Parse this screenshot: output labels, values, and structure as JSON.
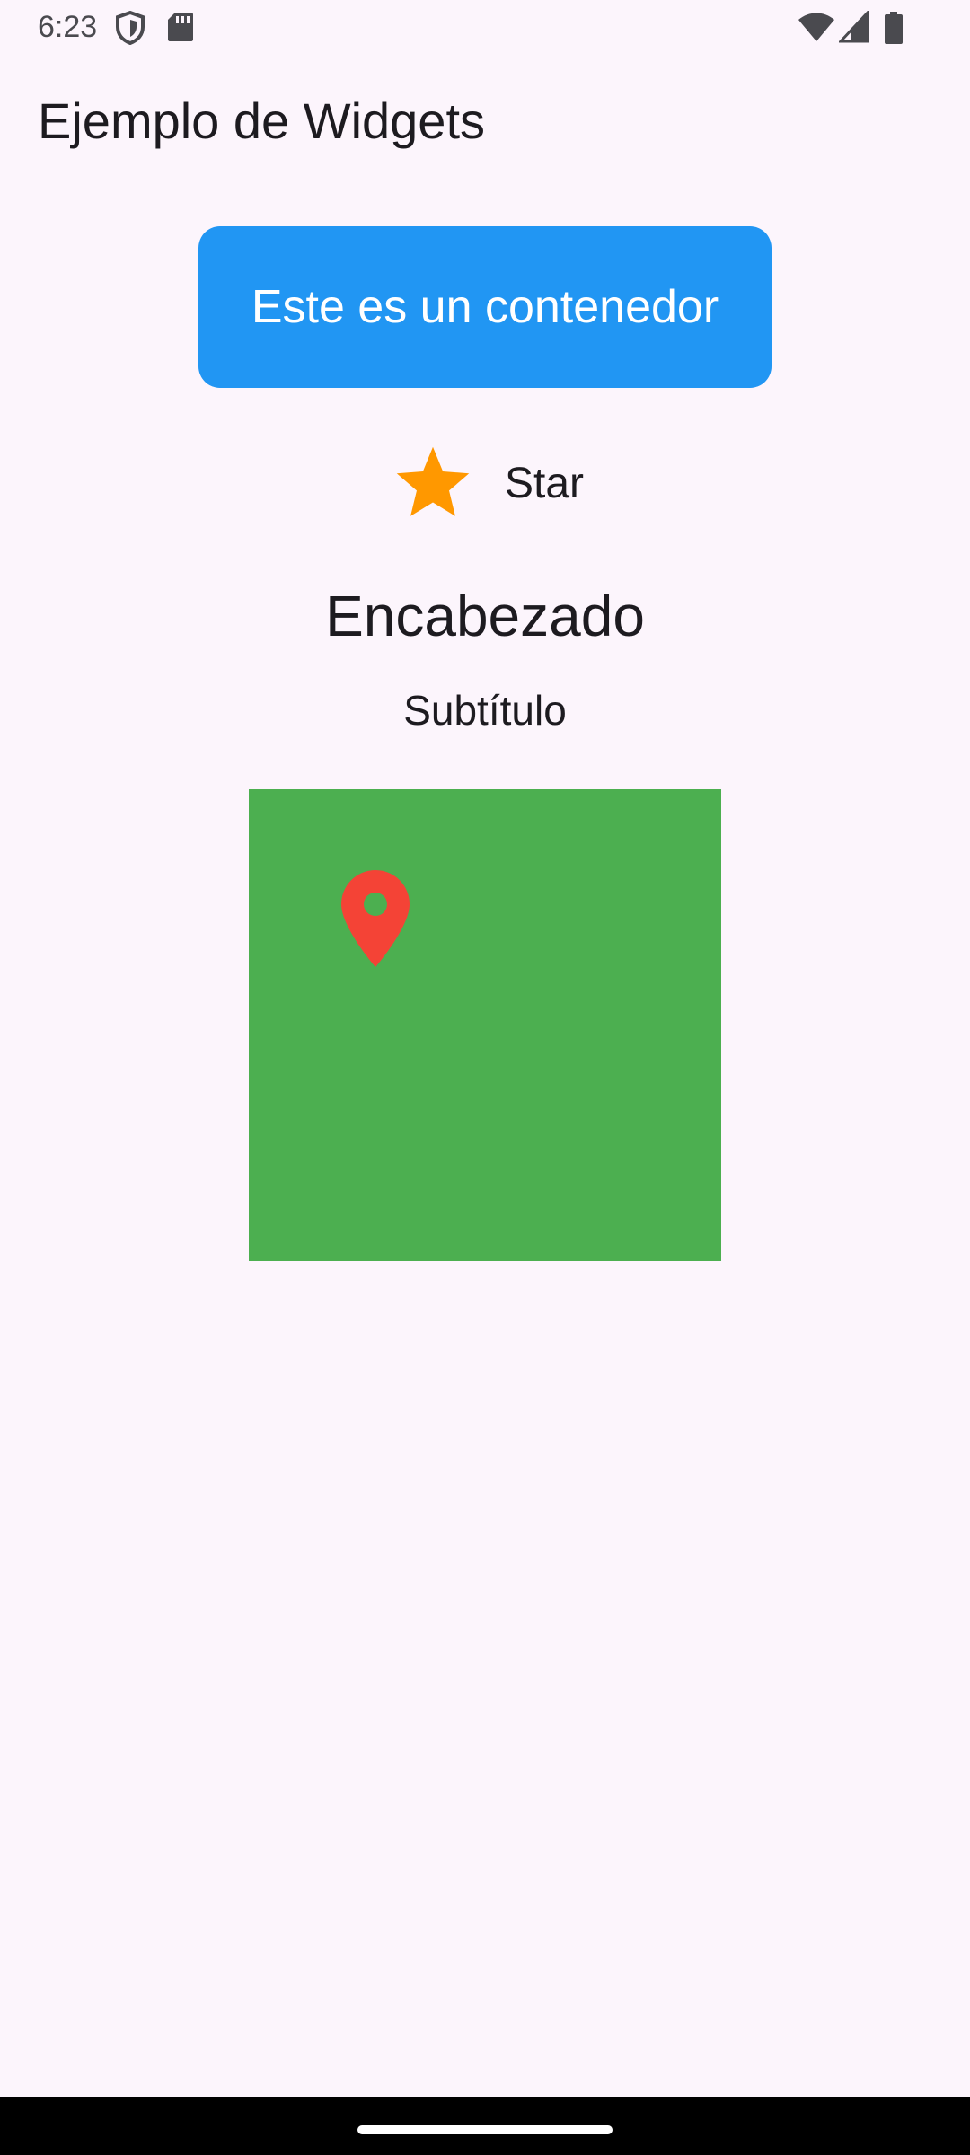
{
  "status_bar": {
    "time": "6:23",
    "icons": [
      "shield-icon",
      "sd-card-icon",
      "wifi-icon",
      "cellular-signal-icon",
      "battery-icon"
    ]
  },
  "app_bar": {
    "title": "Ejemplo de Widgets"
  },
  "container": {
    "text": "Este es un contenedor",
    "color": "#2196F3"
  },
  "star_row": {
    "icon": "star-icon",
    "icon_color": "#FF9800",
    "label": "Star"
  },
  "heading": "Encabezado",
  "subtitle": "Subtítulo",
  "green_box": {
    "color": "#4CAF50",
    "icon": "location-pin-icon",
    "icon_color": "#F44336"
  },
  "colors": {
    "background": "#FCF5FC",
    "text": "#1D1B20"
  }
}
